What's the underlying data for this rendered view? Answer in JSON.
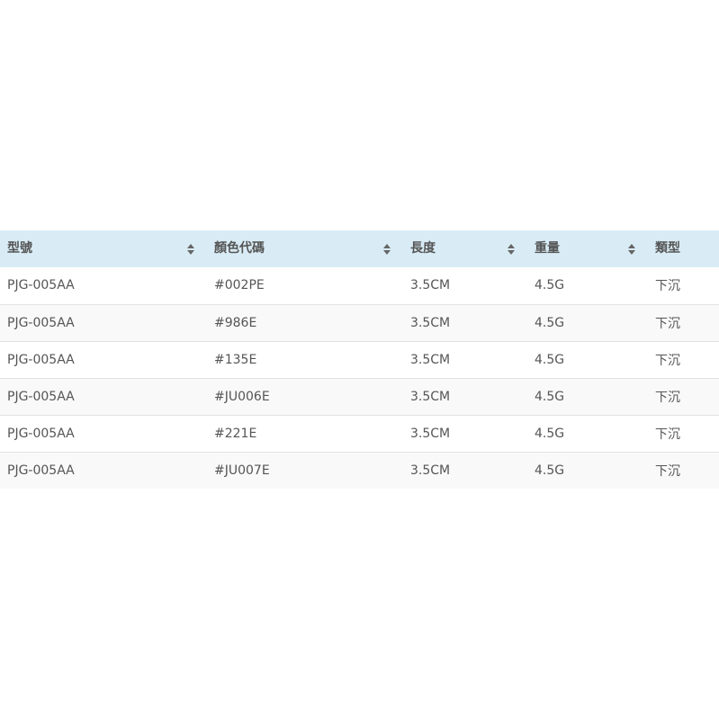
{
  "table": {
    "columns": [
      {
        "label": "型號",
        "sort_icon": "sort-icon"
      },
      {
        "label": "顏色代碼",
        "sort_icon": "sort-icon"
      },
      {
        "label": "長度",
        "sort_icon": "sort-icon"
      },
      {
        "label": "重量",
        "sort_icon": "sort-icon"
      },
      {
        "label": "類型",
        "sort_icon": ""
      }
    ],
    "rows": [
      [
        "PJG-005AA",
        "#002PE",
        "3.5CM",
        "4.5G",
        "下沉"
      ],
      [
        "PJG-005AA",
        "#986E",
        "3.5CM",
        "4.5G",
        "下沉"
      ],
      [
        "PJG-005AA",
        "#135E",
        "3.5CM",
        "4.5G",
        "下沉"
      ],
      [
        "PJG-005AA",
        "#JU006E",
        "3.5CM",
        "4.5G",
        "下沉"
      ],
      [
        "PJG-005AA",
        "#221E",
        "3.5CM",
        "4.5G",
        "下沉"
      ],
      [
        "PJG-005AA",
        "#JU007E",
        "3.5CM",
        "4.5G",
        "下沉"
      ]
    ]
  },
  "colors": {
    "header_bg": "#d9ecf6",
    "text": "#555555",
    "row_alt_bg": "#f9f9f9",
    "row_border": "#e2e2e2"
  }
}
